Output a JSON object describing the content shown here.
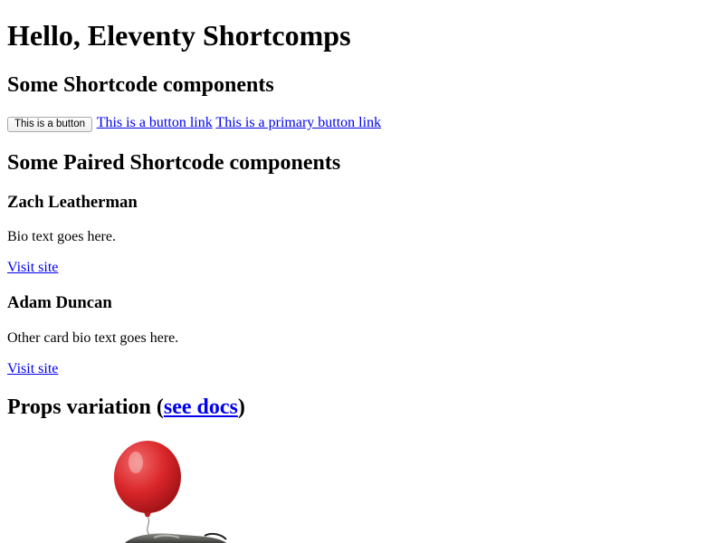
{
  "page": {
    "title": "Hello, Eleventy Shortcomps"
  },
  "shortcode_section": {
    "heading": "Some Shortcode components",
    "button_label": "This is a button",
    "button_link_label": "This is a button link",
    "primary_button_link_label": "This is a primary button link"
  },
  "paired_section": {
    "heading": "Some Paired Shortcode components",
    "cards": [
      {
        "name": "Zach Leatherman",
        "bio": "Bio text goes here.",
        "link_label": "Visit site"
      },
      {
        "name": "Adam Duncan",
        "bio": "Other card bio text goes here.",
        "link_label": "Visit site"
      }
    ]
  },
  "props_section": {
    "heading_prefix": "Props variation (",
    "docs_link_label": "see docs",
    "heading_suffix": ")",
    "image_subject": "possum-with-red-balloon"
  },
  "colors": {
    "link": "#0000ee",
    "balloon": "#d9262a"
  }
}
